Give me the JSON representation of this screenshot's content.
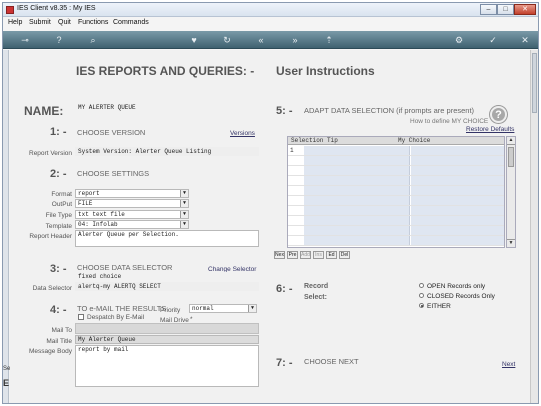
{
  "window": {
    "title": "IES Client v8.35 : My IES",
    "min": "–",
    "max": "□",
    "close": "✕"
  },
  "menu": [
    "Help",
    "Submit",
    "Quit",
    "Functions",
    "Commands"
  ],
  "toolbar_icons": [
    "key-icon",
    "help-icon",
    "search-icon",
    "heart-icon",
    "refresh-icon",
    "rewind-icon",
    "forward-icon",
    "upload-icon",
    "gear-icon",
    "check-icon",
    "close-icon"
  ],
  "left_strip": {
    "top": "Sel",
    "bottom": "E"
  },
  "header": {
    "title": "IES REPORTS AND QUERIES: -",
    "subtitle": "User Instructions"
  },
  "name": {
    "label": "NAME:",
    "value": "MY ALERTER QUEUE"
  },
  "s1": {
    "num": "1: -",
    "title": "CHOOSE VERSION",
    "link": "Versions",
    "version_label": "Report Version",
    "version_value": "System Version: Alerter Queue Listing"
  },
  "s2": {
    "num": "2: -",
    "title": "CHOOSE SETTINGS",
    "format_label": "Format",
    "format_value": "report",
    "output_label": "OutPut",
    "output_value": "FILE",
    "filetype_label": "File Type",
    "filetype_value": "txt text file",
    "template_label": "Template",
    "template_value": "04: Infolab",
    "header_label": "Report Header",
    "header_value": "Alerter Queue per Selection."
  },
  "s3": {
    "num": "3: -",
    "title": "CHOOSE DATA SELECTOR",
    "link": "Change Selector",
    "choice": "fixed choice",
    "selector_label": "Data Selector",
    "selector_value": "alertq-my ALERTQ SELECT"
  },
  "s4": {
    "num": "4: -",
    "title": "TO e-MAIL THE RESULTS",
    "priority_label": "Priority",
    "priority_value": "normal",
    "despatch_label": "Despatch By E-Mail",
    "drive_label": "Mail Drive",
    "drive_value": "*",
    "mailto_label": "Mail To",
    "mailto_value": "",
    "mailtitle_label": "Mail Title",
    "mailtitle_value": "My Alerter Queue",
    "mailbody_label": "Message Body",
    "mailbody_value": "report by mail"
  },
  "s5": {
    "num": "5: -",
    "title": "ADAPT DATA SELECTION (if prompts are present)",
    "howto": "How to define MY CHOICE",
    "restore": "Restore Defaults",
    "col1": "Selection Tip",
    "col2": "My Choice",
    "row1": "1",
    "buttons": [
      "Nex",
      "Pre",
      "Add",
      "Ins",
      "Ed",
      "Del"
    ]
  },
  "s6": {
    "num": "6: -",
    "title": "Record",
    "title2": "Select:",
    "opt1": "OPEN Records only",
    "opt2": "CLOSED Records Only",
    "opt3": "EITHER",
    "selected": "EITHER"
  },
  "s7": {
    "num": "7: -",
    "title": "CHOOSE NEXT",
    "next": "Next"
  }
}
